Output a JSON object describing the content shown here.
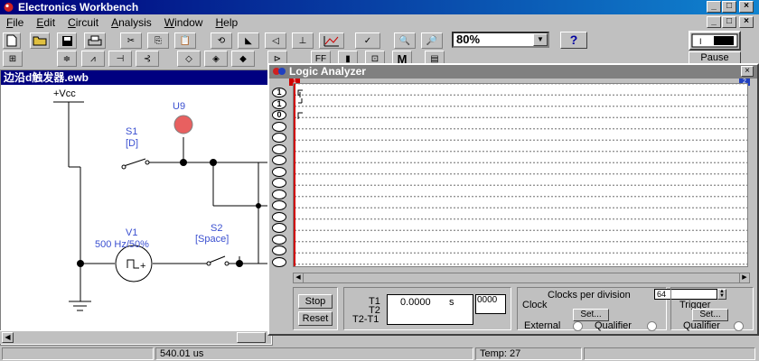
{
  "app": {
    "title": "Electronics Workbench",
    "window_buttons": [
      "_",
      "□",
      "×"
    ]
  },
  "menu": [
    "File",
    "Edit",
    "Circuit",
    "Analysis",
    "Window",
    "Help"
  ],
  "toolbar": {
    "zoom": "80%",
    "help": "?",
    "pause": "Pause"
  },
  "circuit": {
    "title": "边沿d触发器.ewb",
    "vcc": "+Vcc",
    "u9": "U9",
    "s1": "S1",
    "s1_key": "[D]",
    "s2": "S2",
    "s2_key": "[Space]",
    "v1": "V1",
    "v1_value": "500 Hz/50%"
  },
  "analyzer": {
    "title": "Logic Analyzer",
    "channel_labels": [
      "1",
      "1",
      "0",
      "",
      "",
      "",
      "",
      "",
      "",
      "",
      "",
      "",
      "",
      "",
      "",
      ""
    ],
    "marker1": "1",
    "marker2": "2",
    "reverse": "Stop",
    "reset": "Reset",
    "t1": "T1",
    "t2": "T2",
    "t2t1": "T2-T1",
    "time": "0.0000",
    "time_unit": "s",
    "hex": "0000",
    "clocks_label": "Clocks per division",
    "clocks_value": "64",
    "clock_label": "Clock",
    "clock_set": "Set...",
    "external": "External",
    "qualifier": "Qualifier",
    "trigger_label": "Trigger",
    "trigger_set": "Set...",
    "trigger_qualifier": "Qualifier"
  },
  "status": {
    "time": "540.01 us",
    "temp": "Temp:  27"
  }
}
